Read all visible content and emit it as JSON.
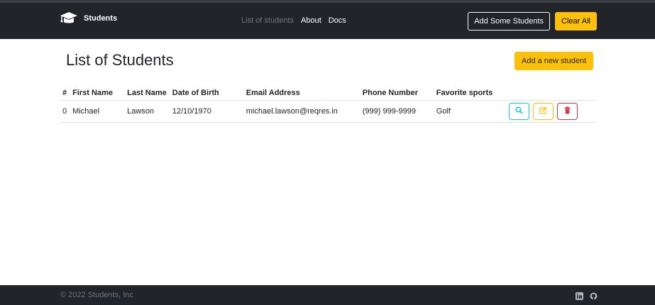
{
  "navbar": {
    "brand": "Students",
    "links": [
      "List of students",
      "About",
      "Docs"
    ],
    "add_some_label": "Add Some Students",
    "clear_all_label": "Clear All"
  },
  "main": {
    "title": "List of Students",
    "add_button_label": "Add a new student"
  },
  "table": {
    "headers": [
      "#",
      "First Name",
      "Last Name",
      "Date of Birth",
      "Email Address",
      "Phone Number",
      "Favorite sports"
    ],
    "rows": [
      {
        "index": "0",
        "first_name": "Michael",
        "last_name": "Lawson",
        "dob": "12/10/1970",
        "email": "michael.lawson@reqres.in",
        "phone": "(999) 999-9999",
        "sport": "Golf"
      }
    ]
  },
  "footer": {
    "copyright": "© 2022 Students, Inc"
  },
  "icons": {
    "brand": "graduation-cap-icon",
    "view": "search-icon",
    "edit": "edit-icon",
    "delete": "trash-icon",
    "linkedin": "linkedin-icon",
    "github": "github-icon"
  },
  "colors": {
    "navbar_bg": "#212529",
    "warning": "#ffc107",
    "info": "#0dcaf0",
    "danger": "#dc3545"
  }
}
